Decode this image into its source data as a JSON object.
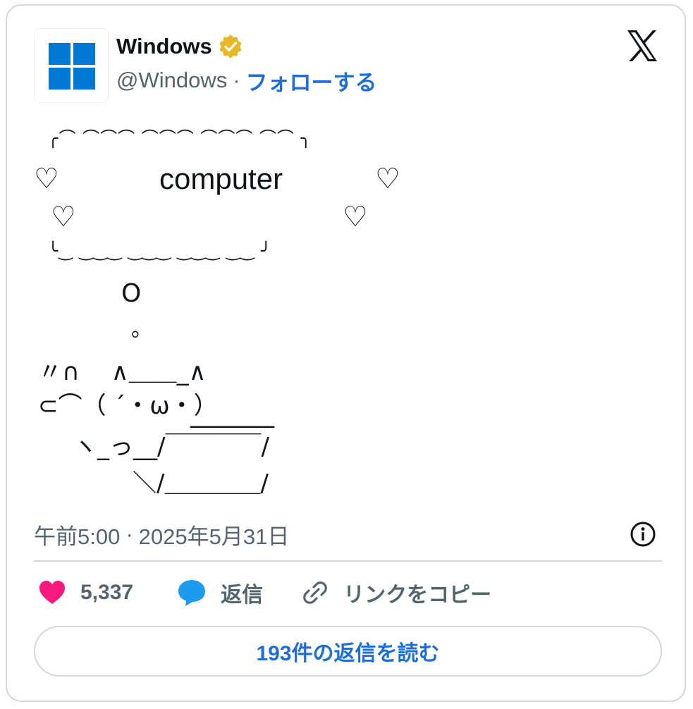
{
  "author": {
    "name": "Windows",
    "handle": "@Windows",
    "separator": "·",
    "follow_label": "フォローする"
  },
  "tweet": {
    "cloud_top": "╭⌒ ⌒⌒⌒ ⌒⌒⌒ ⌒⌒⌒ ⌒⌒ ╮",
    "cloud_word": "computer",
    "cloud_bottom": "╰‿ ‿‿‿ ‿‿‿ ‿‿‿ ‿‿ ╯",
    "heart_glyph": "♡",
    "bubble_large": "O",
    "bubble_small": "。",
    "art_line1": "〃∩　 ∧＿＿_∧",
    "art_line2": "⊂⌒（ ´・ω・）",
    "art_line2b": "_______",
    "art_line3": "ヽ_っ__/￣￣￣￣/",
    "art_line4": "＼/＿＿＿＿/"
  },
  "meta": {
    "time": "午前5:00",
    "separator": "·",
    "date": "2025年5月31日"
  },
  "actions": {
    "likes_count": "5,337",
    "reply_label": "返信",
    "copy_link_label": "リンクをコピー"
  },
  "read_replies_label": "193件の返信を読む",
  "colors": {
    "like": "#f91880",
    "reply": "#1d9bf0",
    "link": "#1d6ed6",
    "muted": "#536471",
    "border": "#cfd9de",
    "windows_blue": "#0078d4",
    "verified_gold": "#e8b829"
  }
}
